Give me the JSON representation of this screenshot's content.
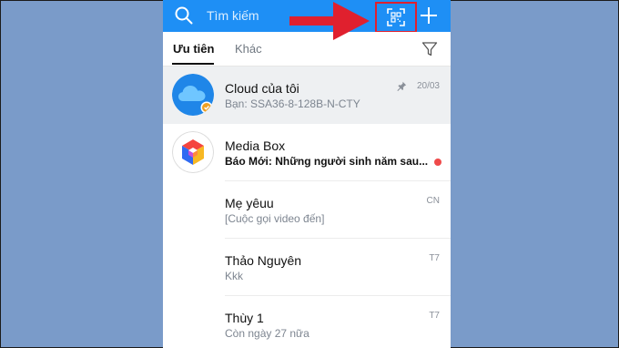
{
  "header": {
    "search_placeholder": "Tìm kiếm",
    "accent_color": "#1e8ff5",
    "highlight_color": "#e0202e"
  },
  "tabs": [
    {
      "label": "Ưu tiên",
      "active": true
    },
    {
      "label": "Khác",
      "active": false
    }
  ],
  "chats": [
    {
      "name": "Cloud của tôi",
      "preview": "Bạn: SSA36-8-128B-N-CTY",
      "time": "20/03",
      "pinned": true
    },
    {
      "name": "Media Box",
      "preview": "Báo Mới: Những người sinh năm sau...",
      "time": "",
      "unread": true
    },
    {
      "name": "Mẹ yêuu",
      "preview": "[Cuộc gọi video đến]",
      "time": "CN"
    },
    {
      "name": "Thảo Nguyên",
      "preview": "Kkk",
      "time": "T7"
    },
    {
      "name": "Thùy 1",
      "preview": "Còn ngày 27 nữa",
      "time": "T7"
    }
  ]
}
